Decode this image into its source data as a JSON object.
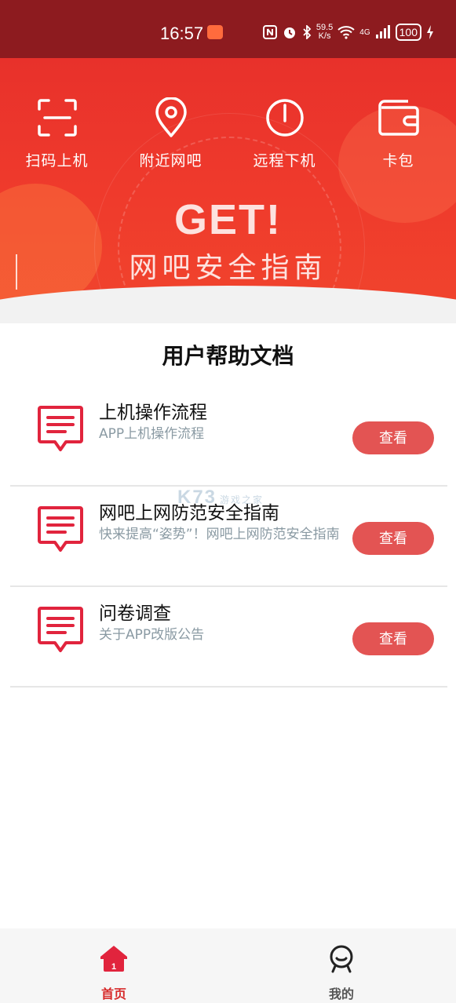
{
  "status_bar": {
    "time": "16:57",
    "net_speed_value": "59.5",
    "net_speed_unit": "K/s",
    "signal_label": "4G",
    "battery": "100"
  },
  "banner": {
    "actions": [
      {
        "label": "扫码上机",
        "icon": "scan-icon"
      },
      {
        "label": "附近网吧",
        "icon": "location-pin-icon"
      },
      {
        "label": "远程下机",
        "icon": "power-icon"
      },
      {
        "label": "卡包",
        "icon": "wallet-icon"
      }
    ],
    "headline": "GET!",
    "subheadline": "网吧安全指南",
    "colors": {
      "primary": "#e8312b",
      "accent": "#e35453"
    }
  },
  "section": {
    "title": "用户帮助文档"
  },
  "docs": [
    {
      "title": "上机操作流程",
      "desc": "APP上机操作流程",
      "button": "查看"
    },
    {
      "title": "网吧上网防范安全指南",
      "desc": "快来提高“姿势”！网吧上网防范安全指南",
      "button": "查看"
    },
    {
      "title": "问卷调查",
      "desc": "关于APP改版公告",
      "button": "查看"
    }
  ],
  "watermark": {
    "brand": "K73",
    "tagline": "游戏之家"
  },
  "tabs": [
    {
      "label": "首页",
      "icon": "home-icon",
      "active": true
    },
    {
      "label": "我的",
      "icon": "profile-icon",
      "active": false
    }
  ]
}
